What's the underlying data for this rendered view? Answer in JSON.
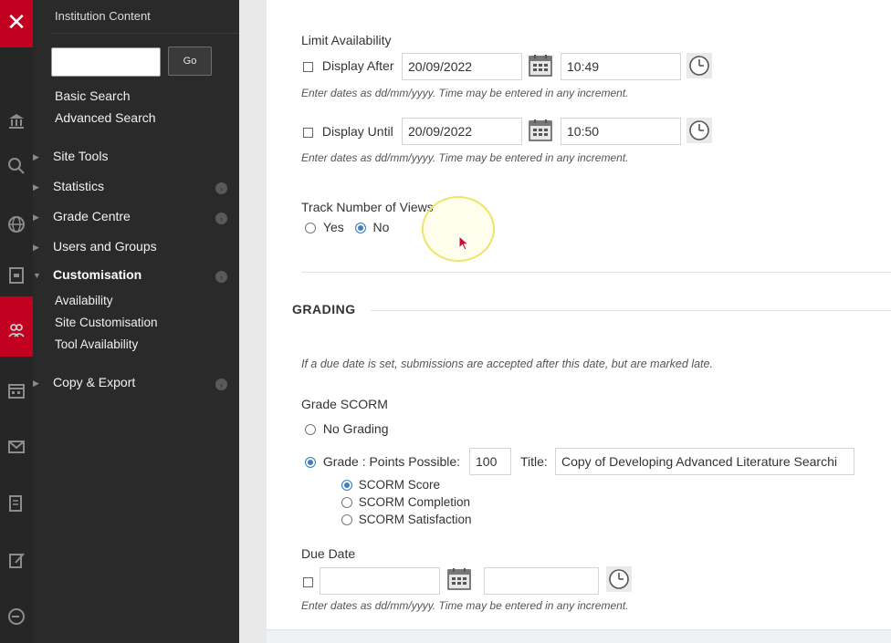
{
  "sidebar": {
    "header": "Institution Content",
    "go_label": "Go",
    "search_placeholder": "",
    "links": [
      "Basic Search",
      "Advanced Search"
    ],
    "items": [
      {
        "label": "Site Tools"
      },
      {
        "label": "Statistics"
      },
      {
        "label": "Grade Centre"
      },
      {
        "label": "Users and Groups"
      },
      {
        "label": "Customisation"
      },
      {
        "label": "Copy & Export"
      }
    ],
    "sub_items": [
      "Availability",
      "Site Customisation",
      "Tool Availability"
    ]
  },
  "limit_availability": {
    "title": "Limit Availability",
    "display_after": {
      "label": "Display After",
      "date": "20/09/2022",
      "time": "10:49"
    },
    "display_until": {
      "label": "Display Until",
      "date": "20/09/2022",
      "time": "10:50"
    },
    "hint": "Enter dates as dd/mm/yyyy. Time may be entered in any increment."
  },
  "track_views": {
    "title": "Track Number of Views",
    "yes": "Yes",
    "no": "No"
  },
  "grading": {
    "section_title": "GRADING",
    "info": "If a due date is set, submissions are accepted after this date, but are marked late.",
    "grade_scorm_label": "Grade SCORM",
    "no_grading": "No Grading",
    "grade_points_label": "Grade : Points Possible:",
    "points_value": "100",
    "title_label": "Title:",
    "title_value": "Copy of Developing Advanced Literature Searchi",
    "options": [
      "SCORM Score",
      "SCORM Completion",
      "SCORM Satisfaction"
    ]
  },
  "due_date": {
    "label": "Due Date",
    "date": "",
    "time": "",
    "hint": "Enter dates as dd/mm/yyyy. Time may be entered in any increment."
  },
  "colors": {
    "accent_red": "#c2001f",
    "radio_blue": "#3c7fc4",
    "sidebar_bg": "#2a2a2a"
  }
}
